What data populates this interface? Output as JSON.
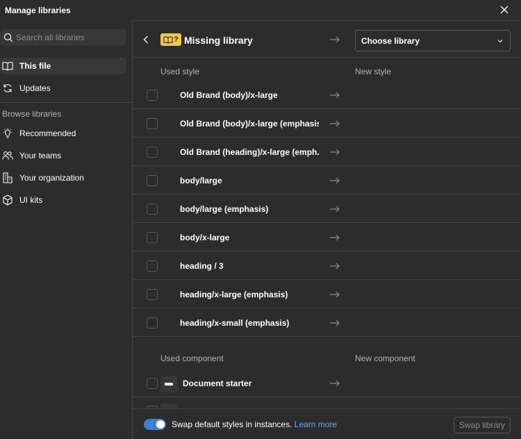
{
  "window": {
    "title": "Manage libraries"
  },
  "sidebar": {
    "search": {
      "placeholder": "Search all libraries"
    },
    "items": [
      {
        "label": "This file",
        "icon": "book-icon"
      },
      {
        "label": "Updates",
        "icon": "refresh-icon"
      }
    ],
    "browse_heading": "Browse libraries",
    "browse_items": [
      {
        "label": "Recommended",
        "icon": "lightbulb-icon"
      },
      {
        "label": "Your teams",
        "icon": "people-icon"
      },
      {
        "label": "Your organization",
        "icon": "building-icon"
      },
      {
        "label": "UI kits",
        "icon": "cube-icon"
      }
    ]
  },
  "main": {
    "badge_text": "?",
    "missing_title": "Missing library",
    "choose_library_label": "Choose library",
    "style_columns": {
      "used": "Used style",
      "new": "New style"
    },
    "styles": [
      "Old Brand (body)/x-large",
      "Old Brand (body)/x-large (emphasis)",
      "Old Brand (heading)/x-large (emph...",
      "body/large",
      "body/large (emphasis)",
      "body/x-large",
      "heading / 3",
      "heading/x-large (emphasis)",
      "heading/x-small (emphasis)"
    ],
    "component_columns": {
      "used": "Used component",
      "new": "New component"
    },
    "components": [
      "Document starter"
    ]
  },
  "footer": {
    "toggle_on": true,
    "swap_text": "Swap default styles in instances.",
    "learn_more": "Learn more",
    "swap_button": "Swap library"
  },
  "colors": {
    "background": "#2c2c2c",
    "accent": "#3b82d6",
    "badge": "#f3c64a",
    "link": "#65a9f3"
  }
}
